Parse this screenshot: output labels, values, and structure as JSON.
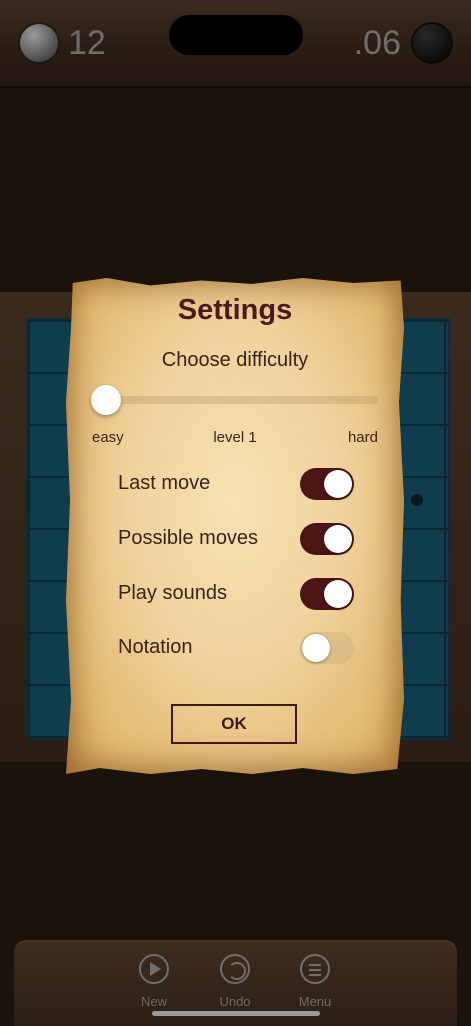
{
  "scoreboard": {
    "white_score": "12",
    "black_score": ".06"
  },
  "settings": {
    "title": "Settings",
    "difficulty_prompt": "Choose difficulty",
    "difficulty_level": 0,
    "slider_labels": {
      "easy": "easy",
      "current": "level 1",
      "hard": "hard"
    },
    "toggles": [
      {
        "label": "Last move",
        "on": true
      },
      {
        "label": "Possible moves",
        "on": true
      },
      {
        "label": "Play sounds",
        "on": true
      },
      {
        "label": "Notation",
        "on": false
      }
    ],
    "ok_label": "OK"
  },
  "toolbar": {
    "new_label": "New",
    "undo_label": "Undo",
    "menu_label": "Menu"
  },
  "colors": {
    "toggle_on": "#4d1416",
    "title": "#4a1a1e",
    "board": "#0f3d4e"
  }
}
